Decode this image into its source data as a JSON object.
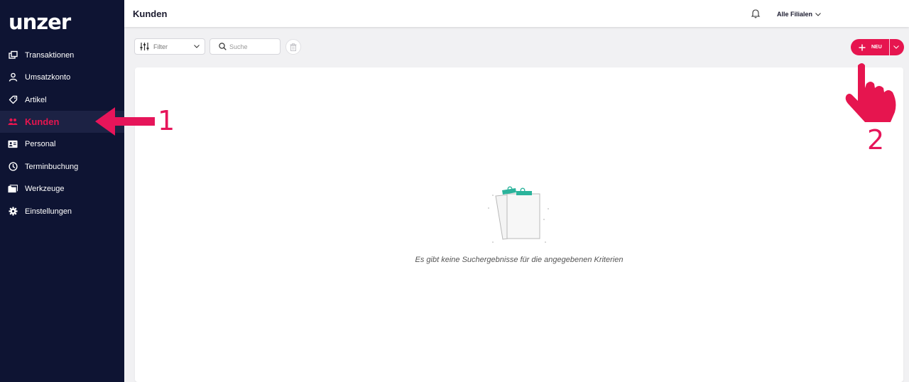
{
  "app": {
    "logo": "unzer"
  },
  "sidebar": {
    "items": [
      {
        "label": "Transaktionen",
        "icon": "transactions-icon"
      },
      {
        "label": "Umsatzkonto",
        "icon": "user-icon"
      },
      {
        "label": "Artikel",
        "icon": "tag-icon"
      },
      {
        "label": "Kunden",
        "icon": "customers-icon",
        "active": true
      },
      {
        "label": "Personal",
        "icon": "id-card-icon"
      },
      {
        "label": "Terminbuchung",
        "icon": "clock-icon"
      },
      {
        "label": "Werkzeuge",
        "icon": "folder-icon"
      },
      {
        "label": "Einstellungen",
        "icon": "gear-icon"
      }
    ]
  },
  "header": {
    "title": "Kunden",
    "branch": "Alle Filialen"
  },
  "toolbar": {
    "filter_label": "Filter",
    "search_placeholder": "Suche",
    "new_label": "NEU"
  },
  "main": {
    "empty_message": "Es gibt keine Suchergebnisse für die angegebenen Kriterien"
  },
  "annotations": {
    "step1": "1",
    "step2": "2"
  },
  "colors": {
    "sidebar_bg": "#0e1433",
    "accent": "#e6154f",
    "empty_illustration": "#2bb39b"
  }
}
